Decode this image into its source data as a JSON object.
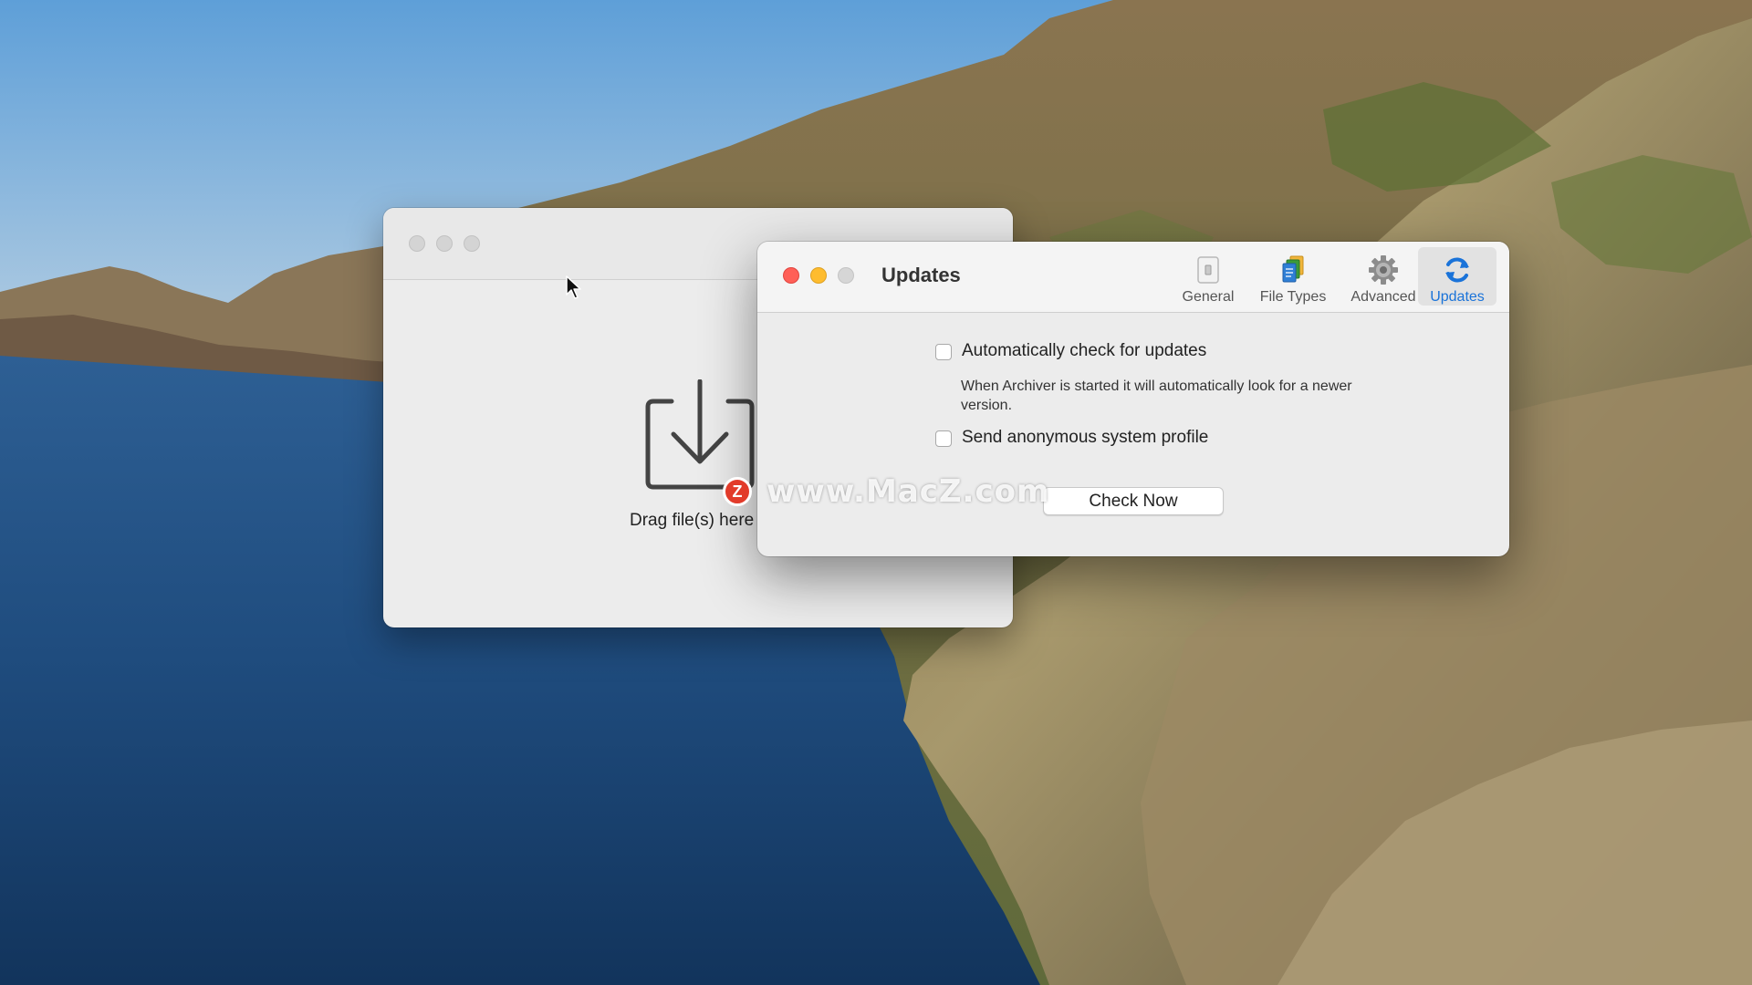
{
  "main_window": {
    "drop_label": "Drag file(s) here"
  },
  "prefs_window": {
    "title": "Updates",
    "toolbar": [
      {
        "label": "General",
        "icon": "general-icon"
      },
      {
        "label": "File Types",
        "icon": "file-types-icon"
      },
      {
        "label": "Advanced",
        "icon": "gear-icon"
      },
      {
        "label": "Updates",
        "icon": "refresh-icon",
        "selected": true
      }
    ],
    "auto_check": {
      "label": "Automatically check for updates",
      "description": "When Archiver is started it will automatically look for a newer version.",
      "checked": false
    },
    "send_profile": {
      "label": "Send anonymous system profile",
      "checked": false
    },
    "check_now_label": "Check Now"
  },
  "watermark": {
    "logo_letter": "Z",
    "text": "www.MacZ.com"
  },
  "colors": {
    "accent": "#1a73d9",
    "close": "#ff5f57",
    "minimize": "#febc2e"
  }
}
